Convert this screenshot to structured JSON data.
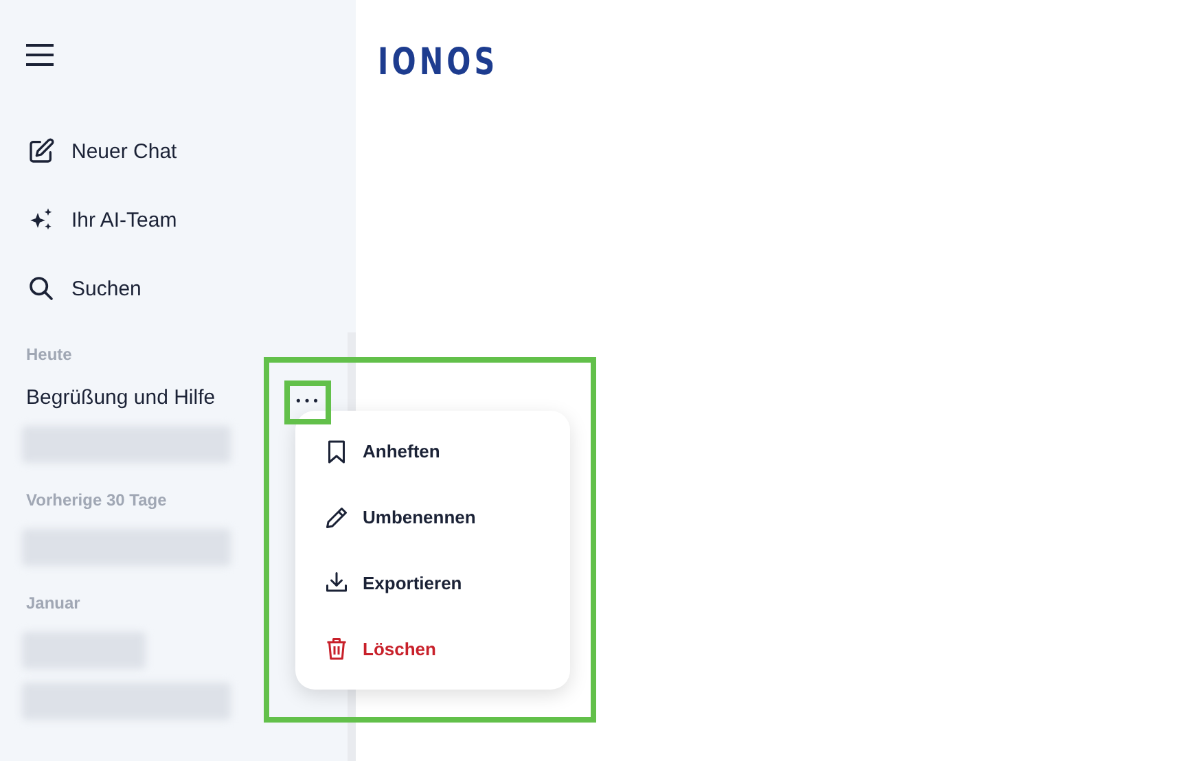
{
  "logo": "IONOS",
  "nav": [
    {
      "kind": "compose",
      "label": "Neuer Chat"
    },
    {
      "kind": "sparkle",
      "label": "Ihr AI-Team"
    },
    {
      "kind": "search",
      "label": "Suchen"
    }
  ],
  "history": [
    {
      "heading": "Heute",
      "items": [
        {
          "kind": "chat",
          "label": "Begrüßung und Hilfe"
        },
        {
          "kind": "blurred_long"
        }
      ]
    },
    {
      "heading": "Vorherige 30 Tage",
      "items": [
        {
          "kind": "blurred_long"
        }
      ]
    },
    {
      "heading": "Januar",
      "items": [
        {
          "kind": "blurred_short"
        },
        {
          "kind": "blurred_long"
        }
      ]
    }
  ],
  "more_button": "•••",
  "context_menu": [
    {
      "kind": "pin",
      "label": "Anheften"
    },
    {
      "kind": "rename",
      "label": "Umbenennen"
    },
    {
      "kind": "export",
      "label": "Exportieren"
    },
    {
      "kind": "delete",
      "label": "Löschen"
    }
  ]
}
